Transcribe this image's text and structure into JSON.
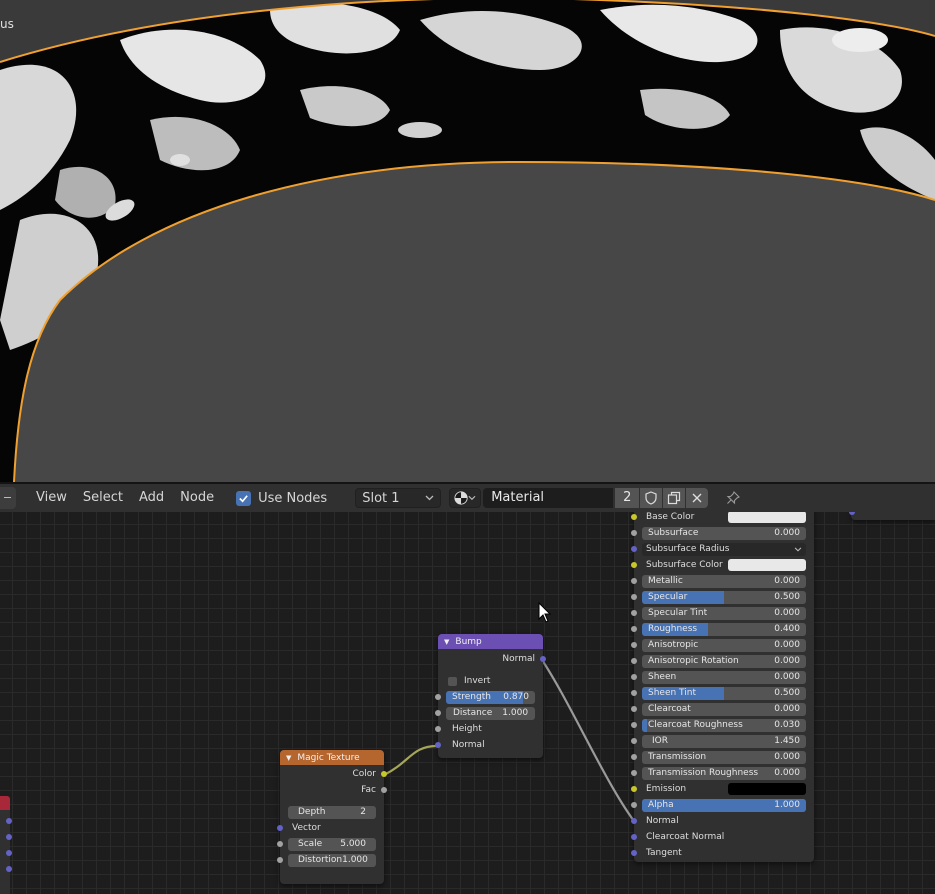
{
  "viewport": {
    "label": "us"
  },
  "header": {
    "menus": [
      "View",
      "Select",
      "Add",
      "Node"
    ],
    "use_nodes_label": "Use Nodes",
    "use_nodes_checked": true,
    "slot": "Slot 1",
    "material_name": "Material",
    "material_users": "2",
    "icons": {
      "fake_user": "shield-icon",
      "duplicate": "duplicate-icon",
      "unlink": "close-icon",
      "pin": "pin-icon",
      "material_type": "material-sphere-icon"
    }
  },
  "bump_node": {
    "title": "Bump",
    "header_color": "#6b4fb3",
    "output_normal": "Normal",
    "invert_label": "Invert",
    "strength_label": "Strength",
    "strength_value": "0.870",
    "strength_fraction": 0.87,
    "distance_label": "Distance",
    "distance_value": "1.000",
    "height_label": "Height",
    "normal_label": "Normal"
  },
  "magic_node": {
    "title": "Magic Texture",
    "header_color": "#b5652e",
    "color_label": "Color",
    "fac_label": "Fac",
    "depth_label": "Depth",
    "depth_value": "2",
    "vector_label": "Vector",
    "scale_label": "Scale",
    "scale_value": "5.000",
    "distortion_label": "Distortion",
    "distortion_value": "1.000"
  },
  "bsdf_node": {
    "rows": [
      {
        "label": "Base Color",
        "type": "color",
        "swatch": "#e8e8e8",
        "socket": "yellow"
      },
      {
        "label": "Subsurface",
        "value": "0.000",
        "fill": 0,
        "socket": "gray"
      },
      {
        "label": "Subsurface Radius",
        "type": "dropdown",
        "socket": "violet"
      },
      {
        "label": "Subsurface Color",
        "type": "color",
        "swatch": "#e8e8e8",
        "socket": "yellow"
      },
      {
        "label": "Metallic",
        "value": "0.000",
        "fill": 0,
        "socket": "gray"
      },
      {
        "label": "Specular",
        "value": "0.500",
        "fill": 0.5,
        "socket": "gray"
      },
      {
        "label": "Specular Tint",
        "value": "0.000",
        "fill": 0,
        "socket": "gray"
      },
      {
        "label": "Roughness",
        "value": "0.400",
        "fill": 0.4,
        "socket": "gray"
      },
      {
        "label": "Anisotropic",
        "value": "0.000",
        "fill": 0,
        "socket": "gray"
      },
      {
        "label": "Anisotropic Rotation",
        "value": "0.000",
        "fill": 0,
        "socket": "gray"
      },
      {
        "label": "Sheen",
        "value": "0.000",
        "fill": 0,
        "socket": "gray"
      },
      {
        "label": "Sheen Tint",
        "value": "0.500",
        "fill": 0.5,
        "socket": "gray"
      },
      {
        "label": "Clearcoat",
        "value": "0.000",
        "fill": 0,
        "socket": "gray"
      },
      {
        "label": "Clearcoat Roughness",
        "value": "0.030",
        "fill": 0.03,
        "socket": "gray"
      },
      {
        "label": "IOR",
        "value": "1.450",
        "fill": 0,
        "socket": "gray",
        "type": "number"
      },
      {
        "label": "Transmission",
        "value": "0.000",
        "fill": 0,
        "socket": "gray"
      },
      {
        "label": "Transmission Roughness",
        "value": "0.000",
        "fill": 0,
        "socket": "gray"
      },
      {
        "label": "Emission",
        "type": "color",
        "swatch": "#000000",
        "socket": "yellow"
      },
      {
        "label": "Alpha",
        "value": "1.000",
        "fill": 1,
        "socket": "gray"
      },
      {
        "label": "Normal",
        "type": "socket",
        "socket": "violet"
      },
      {
        "label": "Clearcoat Normal",
        "type": "socket",
        "socket": "violet"
      },
      {
        "label": "Tangent",
        "type": "socket",
        "socket": "violet"
      }
    ]
  },
  "colors": {
    "accent": "#4772b3",
    "selection_outline": "#f0a030",
    "canvas_bg": "#1d1d1d",
    "node_bg": "#303030"
  }
}
